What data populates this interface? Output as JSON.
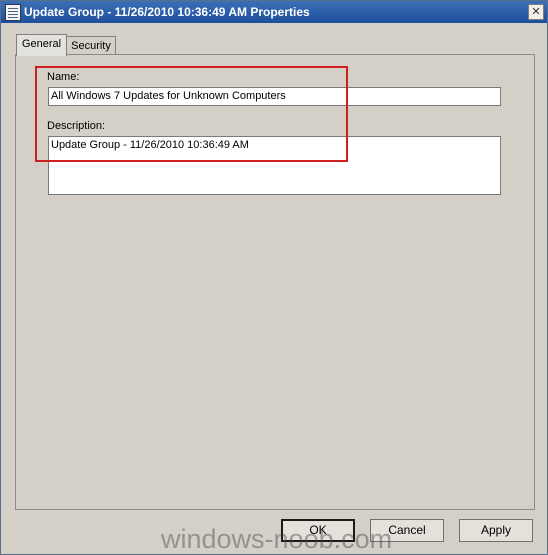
{
  "window": {
    "title": "Update Group - 11/26/2010 10:36:49 AM Properties",
    "close_glyph": "✕"
  },
  "tabs": [
    {
      "label": "General",
      "active": true
    },
    {
      "label": "Security",
      "active": false
    }
  ],
  "form": {
    "name_label": "Name:",
    "name_value": "All Windows 7 Updates for Unknown Computers",
    "description_label": "Description:",
    "description_value": "Update Group - 11/26/2010 10:36:49 AM"
  },
  "buttons": {
    "ok": "OK",
    "cancel": "Cancel",
    "apply": "Apply"
  },
  "watermark": "windows-noob.com",
  "colors": {
    "highlight": "#cc1f1f",
    "titlebar": "#2a5ca8",
    "dialog_bg": "#d4d0c8"
  },
  "icons": {
    "title": "properties-icon",
    "close": "close-icon"
  }
}
